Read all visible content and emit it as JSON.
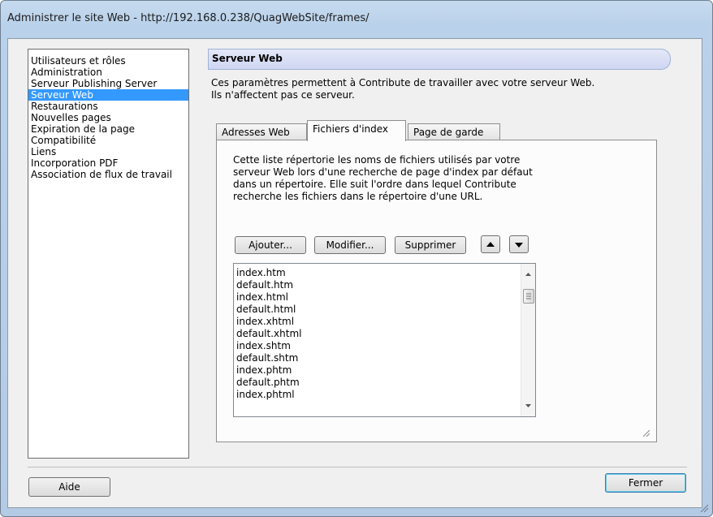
{
  "window": {
    "title": "Administrer le site Web - http://192.168.0.238/QuagWebSite/frames/"
  },
  "sidebar": {
    "items": [
      {
        "label": "Utilisateurs et rôles"
      },
      {
        "label": "Administration"
      },
      {
        "label": "Serveur Publishing Server"
      },
      {
        "label": "Serveur Web",
        "selected": true
      },
      {
        "label": "Restaurations"
      },
      {
        "label": "Nouvelles pages"
      },
      {
        "label": "Expiration de la page"
      },
      {
        "label": "Compatibilité"
      },
      {
        "label": "Liens"
      },
      {
        "label": "Incorporation PDF"
      },
      {
        "label": "Association de flux de travail"
      }
    ]
  },
  "section": {
    "title": "Serveur Web",
    "description_line1": "Ces paramètres permettent à Contribute de travailler avec votre serveur Web.",
    "description_line2": "Ils n'affectent pas ce serveur."
  },
  "tabs": [
    {
      "label": "Adresses Web"
    },
    {
      "label": "Fichiers d'index",
      "active": true
    },
    {
      "label": "Page de garde"
    }
  ],
  "panel": {
    "description_lines": [
      "Cette liste répertorie les noms de fichiers utilisés par votre",
      "serveur Web lors d'une recherche de page d'index par défaut",
      "dans un répertoire. Elle suit l'ordre dans lequel Contribute",
      "recherche les fichiers dans le répertoire d'une URL."
    ],
    "buttons": {
      "add": "Ajouter...",
      "modify": "Modifier...",
      "delete": "Supprimer"
    },
    "files": [
      "index.htm",
      "default.htm",
      "index.html",
      "default.html",
      "index.xhtml",
      "default.xhtml",
      "index.shtm",
      "default.shtm",
      "index.phtm",
      "default.phtm",
      "index.phtml"
    ]
  },
  "footer": {
    "help": "Aide",
    "close": "Fermer"
  },
  "colors": {
    "selection": "#3399ff",
    "section_bar": "#d6dcf5",
    "title_bar": "#b9d1ea"
  }
}
